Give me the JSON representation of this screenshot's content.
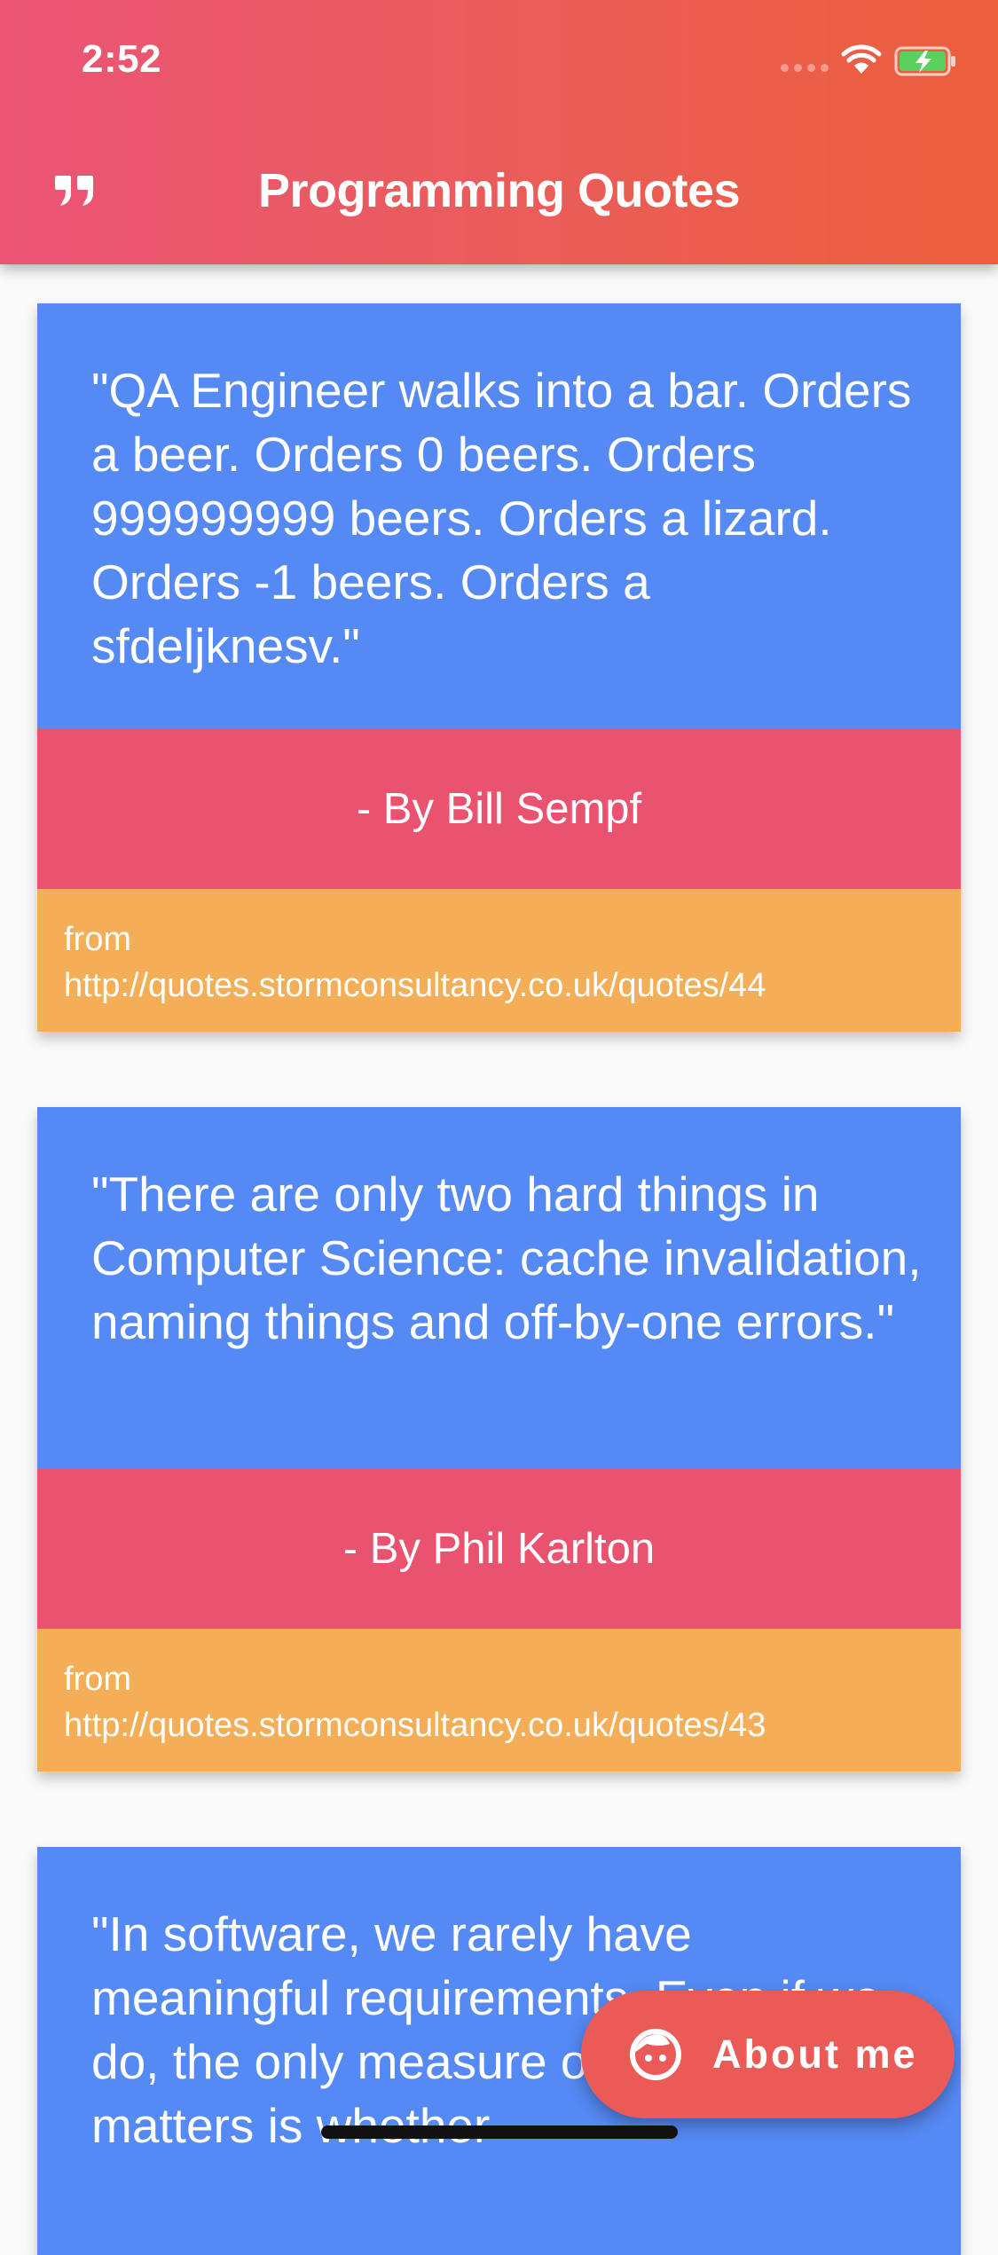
{
  "status_bar": {
    "time": "2:52",
    "icons": [
      "signal-dots-icon",
      "wifi-icon",
      "battery-charging-icon"
    ]
  },
  "app_bar": {
    "icon": "format-quote-icon",
    "title": "Programming Quotes"
  },
  "quotes": [
    {
      "text": "\"QA Engineer walks into a bar. Orders a beer. Orders 0 beers. Orders 999999999 beers. Orders a lizard. Orders -1 beers. Orders a sfdeljknesv.\"",
      "author": "- By Bill Sempf",
      "source": "from\nhttp://quotes.stormconsultancy.co.uk/quotes/44"
    },
    {
      "text": "\"There are only two hard things in Computer Science: cache invalidation, naming things and off-by-one errors.\"",
      "author": "- By Phil Karlton",
      "source": "from\nhttp://quotes.stormconsultancy.co.uk/quotes/43"
    },
    {
      "text": "\"In software, we rarely have meaningful requirements. Even if we do, the only measure of success that matters is whether"
    }
  ],
  "fab": {
    "icon": "face-icon",
    "label": "About me"
  },
  "colors": {
    "header_gradient_start": "#ea5576",
    "header_gradient_end": "#ec5e3c",
    "quote_body": "#5589f3",
    "quote_author": "#e95370",
    "quote_source": "#f4ae58",
    "fab": "#ea5b57",
    "background": "#fafafa"
  }
}
